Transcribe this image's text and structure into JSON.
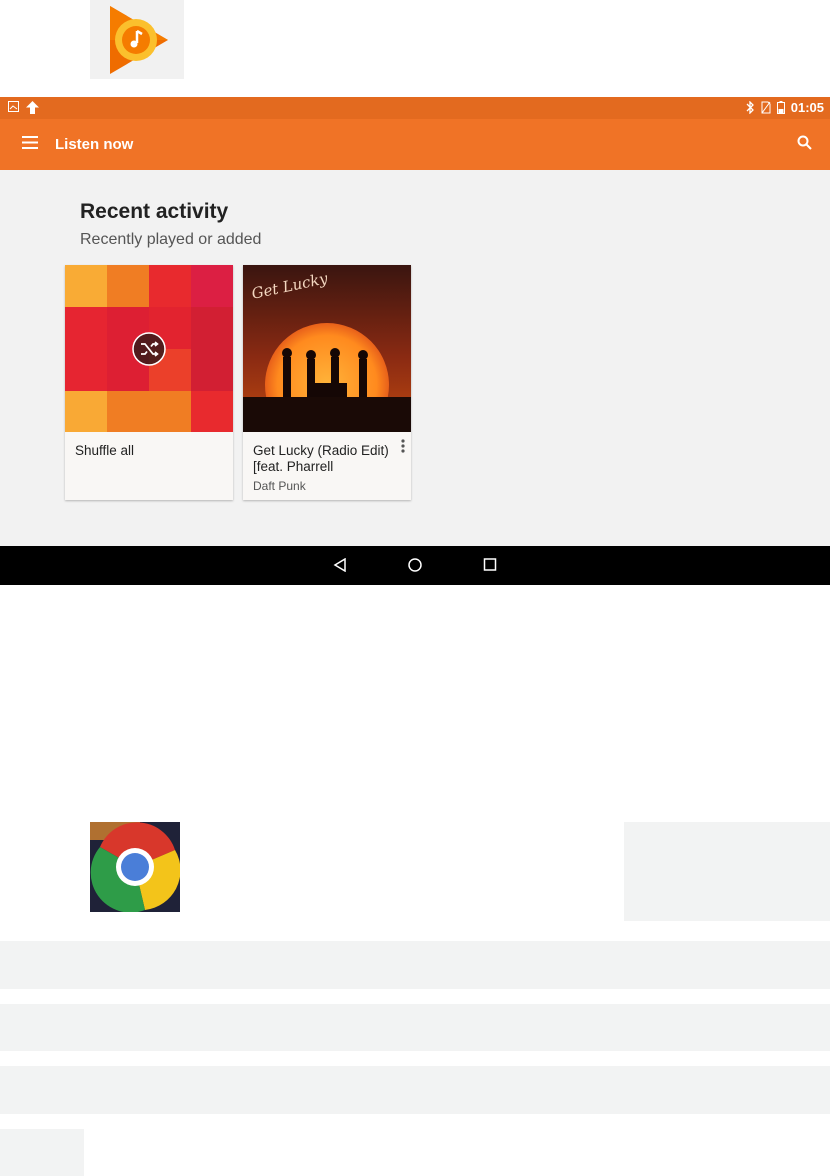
{
  "status_bar": {
    "time": "01:05"
  },
  "toolbar": {
    "title": "Listen now"
  },
  "recent": {
    "title": "Recent activity",
    "subtitle": "Recently played or added"
  },
  "cards": [
    {
      "title": "Shuffle all",
      "subtitle": ""
    },
    {
      "title": "Get Lucky (Radio Edit) [feat. Pharrell",
      "subtitle": "Daft Punk",
      "album_art_text": "Get Lucky"
    }
  ],
  "colors": {
    "toolbar": "#f07326",
    "status_bar": "#e36a1f",
    "nav_bar": "#000000"
  },
  "icons": [
    "play-music-app-icon",
    "menu-icon",
    "search-icon",
    "shuffle-icon",
    "more-vert-icon",
    "back-icon",
    "home-icon",
    "recents-icon",
    "chrome-app-icon"
  ]
}
